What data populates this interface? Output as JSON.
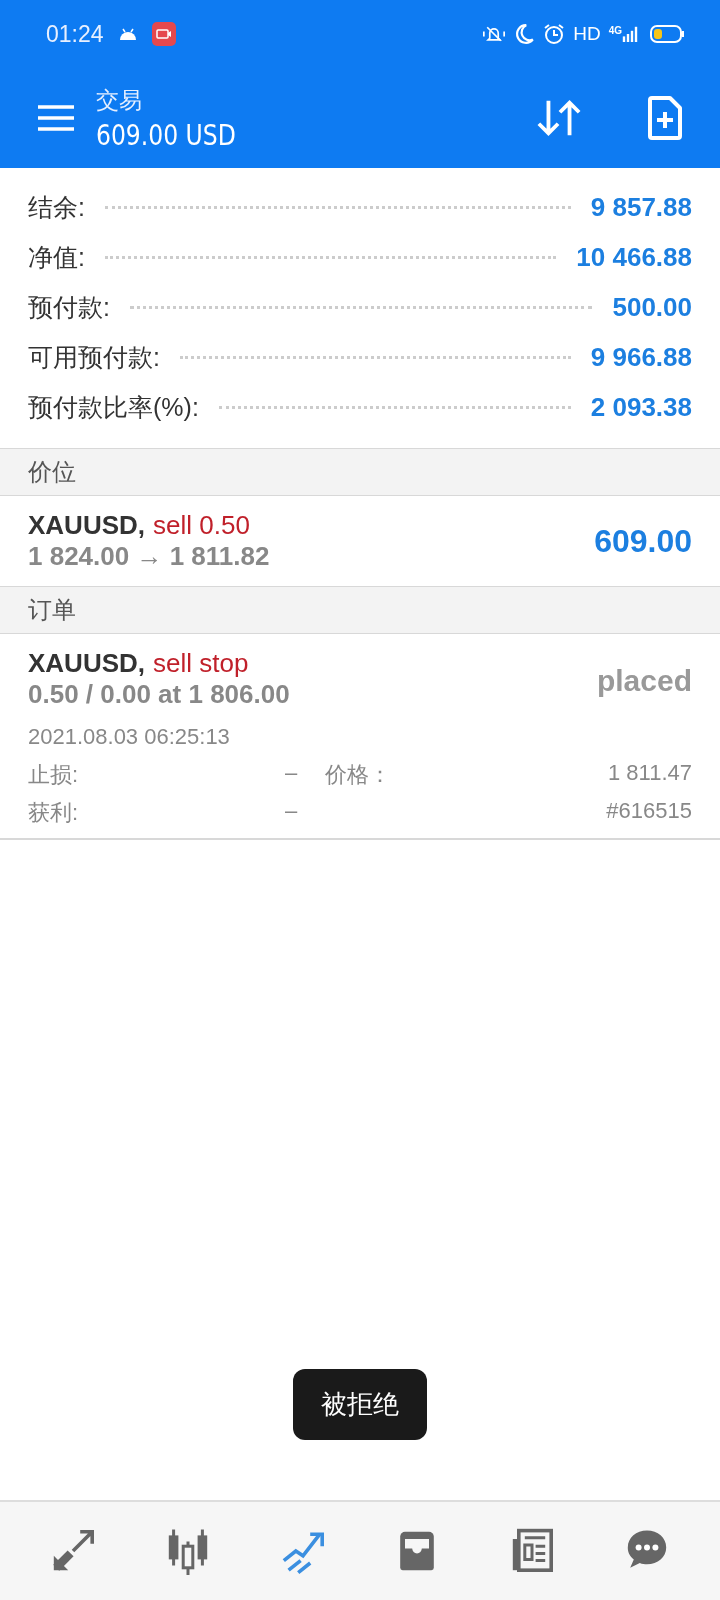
{
  "status_bar": {
    "time": "01:24",
    "hd": "HD",
    "network": "4G"
  },
  "header": {
    "title": "交易",
    "subtitle": "609.00 USD"
  },
  "summary": [
    {
      "label": "结余:",
      "value": "9 857.88"
    },
    {
      "label": "净值:",
      "value": "10 466.88"
    },
    {
      "label": "预付款:",
      "value": "500.00"
    },
    {
      "label": "可用预付款:",
      "value": "9 966.88"
    },
    {
      "label": "预付款比率(%):",
      "value": "2 093.38"
    }
  ],
  "positions": {
    "title": "价位",
    "items": [
      {
        "symbol": "XAUUSD,",
        "action": "sell 0.50",
        "prices": "1 824.00 → 1 811.82",
        "profit": "609.00"
      }
    ]
  },
  "orders": {
    "title": "订单",
    "items": [
      {
        "symbol": "XAUUSD,",
        "action": "sell stop",
        "volume": "0.50 / 0.00 at 1 806.00",
        "state": "placed",
        "time": "2021.08.03 06:25:13",
        "sl_label": "止损:",
        "sl_value": "–",
        "price_label": "价格：",
        "price_value": "1 811.47",
        "tp_label": "获利:",
        "tp_value": "–",
        "ticket": "#616515"
      }
    ]
  },
  "toast": "被拒绝",
  "nav": [
    {
      "kind": "quotes",
      "selected": false
    },
    {
      "kind": "chart",
      "selected": false
    },
    {
      "kind": "trade",
      "selected": true
    },
    {
      "kind": "history",
      "selected": false
    },
    {
      "kind": "news",
      "selected": false
    },
    {
      "kind": "chat",
      "selected": false
    }
  ]
}
